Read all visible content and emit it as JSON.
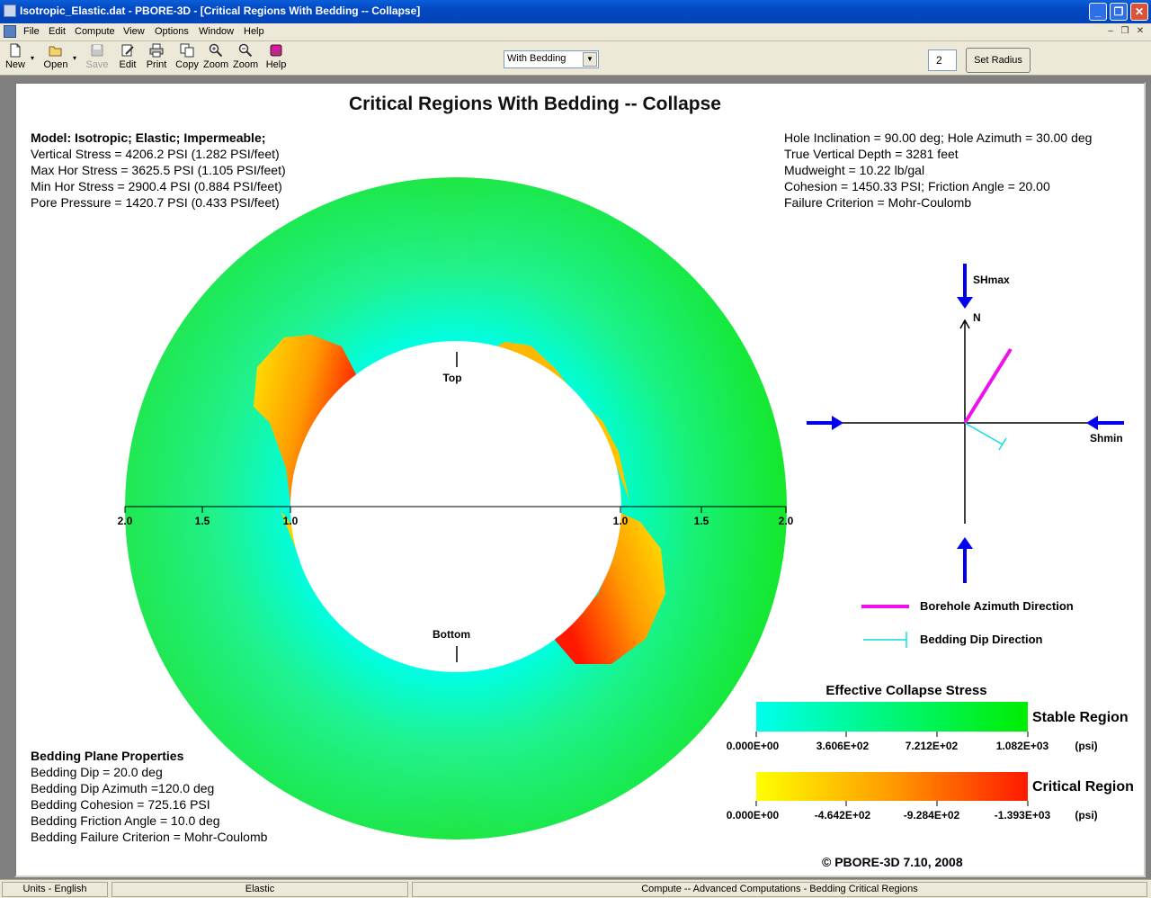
{
  "window": {
    "title": "Isotropic_Elastic.dat - PBORE-3D  - [Critical Regions With Bedding -- Collapse]"
  },
  "menu": [
    "File",
    "Edit",
    "Compute",
    "View",
    "Options",
    "Window",
    "Help"
  ],
  "toolbar": {
    "new": "New",
    "open": "Open",
    "save": "Save",
    "edit": "Edit",
    "print": "Print",
    "copy": "Copy",
    "zoom_in": "Zoom",
    "zoom_out": "Zoom",
    "help": "Help",
    "view_select": "With Bedding",
    "radius_value": "2",
    "set_radius": "Set Radius"
  },
  "plot": {
    "title": "Critical Regions With Bedding -- Collapse",
    "model": {
      "heading": "Model: Isotropic; Elastic; Impermeable;",
      "lines": [
        "Vertical Stress = 4206.2 PSI (1.282 PSI/feet)",
        "Max Hor Stress = 3625.5 PSI (1.105 PSI/feet)",
        "Min Hor Stress = 2900.4 PSI (0.884 PSI/feet)",
        "Pore Pressure = 1420.7 PSI (0.433 PSI/feet)"
      ]
    },
    "hole": {
      "lines": [
        "Hole Inclination = 90.00 deg;   Hole Azimuth = 30.00 deg",
        "True Vertical Depth = 3281 feet",
        "Mudweight = 10.22 lb/gal",
        "Cohesion = 1450.33 PSI; Friction Angle = 20.00",
        "Failure Criterion = Mohr-Coulomb"
      ]
    },
    "bedding": {
      "heading": "Bedding Plane Properties",
      "lines": [
        "Bedding Dip = 20.0 deg",
        "Bedding Dip Azimuth =120.0 deg",
        "Bedding Cohesion = 725.16 PSI",
        "Bedding Friction Angle = 10.0 deg",
        "Bedding Failure Criterion = Mohr-Coulomb"
      ]
    },
    "wellbore": {
      "top_label": "Top",
      "bottom_label": "Bottom",
      "radius_ticks": [
        "2.0",
        "1.5",
        "1.0",
        "1.0",
        "1.5",
        "2.0"
      ]
    },
    "compass": {
      "shmax": "SHmax",
      "north": "N",
      "shmin": "Shmin",
      "legend_azimuth": "Borehole Azimuth Direction",
      "legend_dip": "Bedding Dip Direction"
    },
    "scale": {
      "title": "Effective Collapse Stress",
      "stable_label": "Stable Region",
      "critical_label": "Critical Region",
      "stable_ticks": [
        "0.000E+00",
        "3.606E+02",
        "7.212E+02",
        "1.082E+03"
      ],
      "critical_ticks": [
        "0.000E+00",
        "-4.642E+02",
        "-9.284E+02",
        "-1.393E+03"
      ],
      "unit": "(psi)"
    },
    "copyright": "©  PBORE-3D 7.10, 2008"
  },
  "status": {
    "units": "Units - English",
    "mode": "Elastic",
    "action": "Compute -- Advanced Computations - Bedding Critical Regions"
  },
  "colors": {
    "title_bar": "#0348c2",
    "stable_low": "#00ffee",
    "stable_high": "#00ee00",
    "critical_low": "#ffff00",
    "critical_high": "#ff1a00",
    "azimuth_line": "#ee11ee",
    "dip_line": "#11dddd",
    "stress_arrow": "#0000ee"
  }
}
